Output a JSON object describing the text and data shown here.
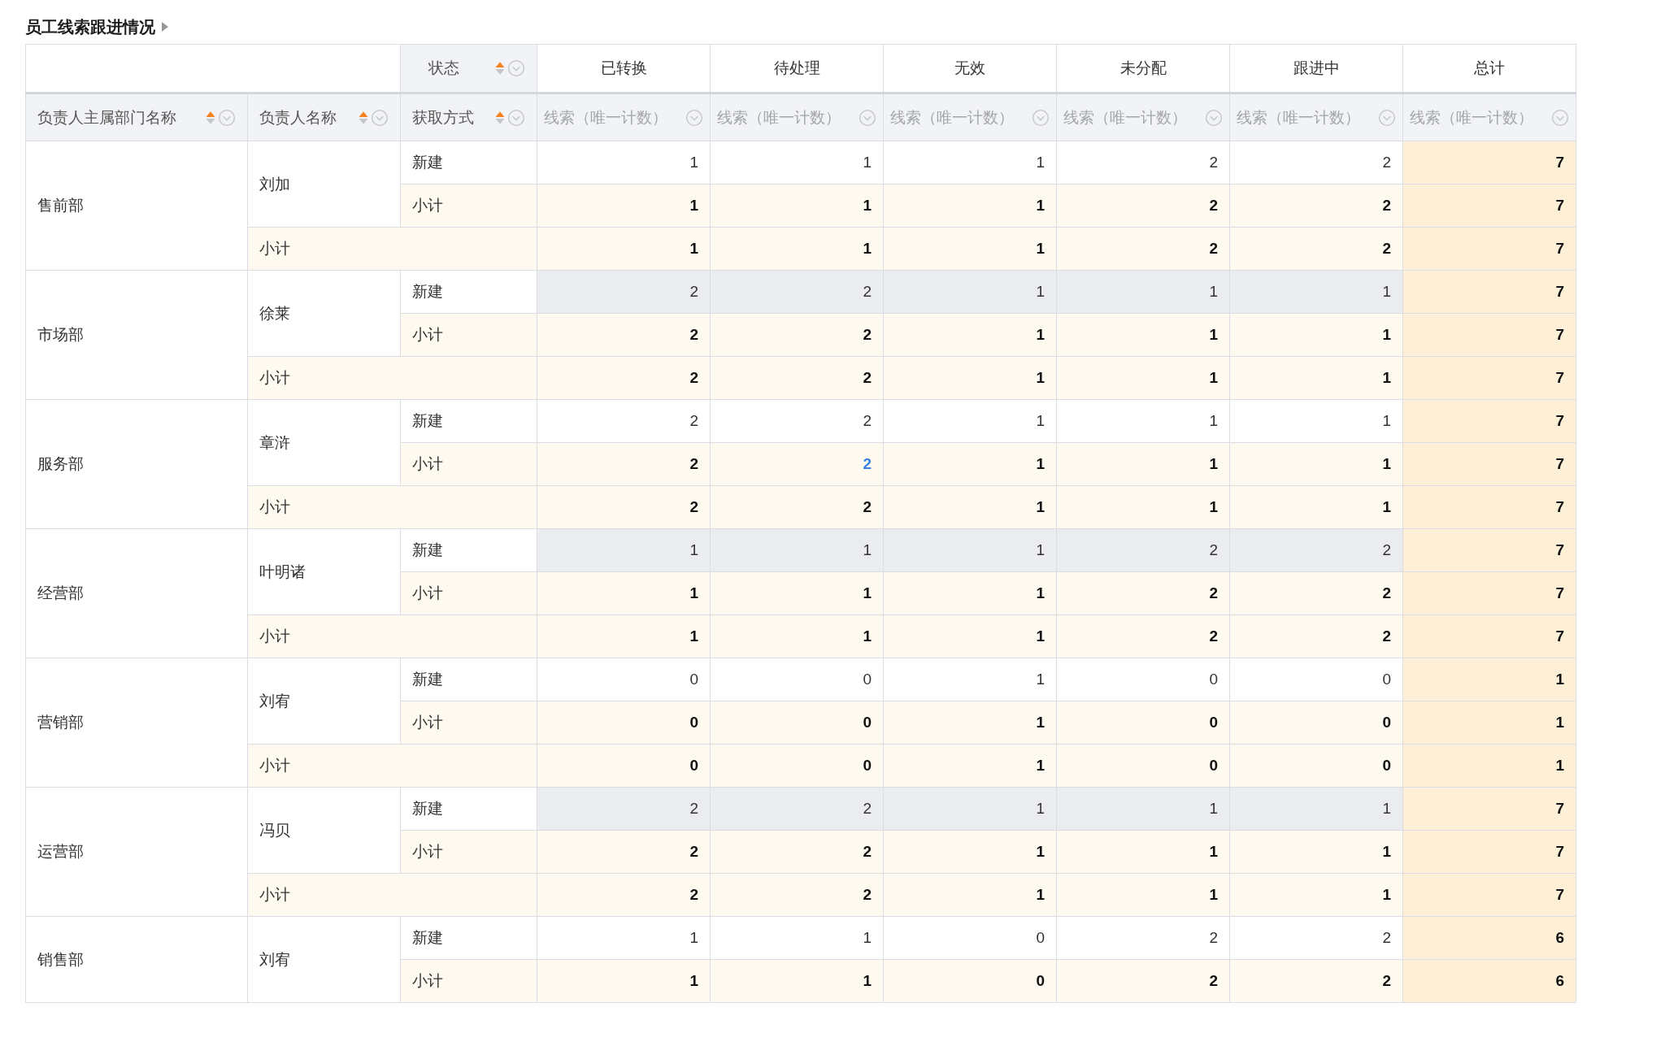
{
  "title": "员工线索跟进情况",
  "column_header": {
    "label": "状态"
  },
  "row_headers": [
    "负责人主属部门名称",
    "负责人名称",
    "获取方式"
  ],
  "columns": [
    {
      "label": "已转换",
      "measure": "线索（唯一计数）"
    },
    {
      "label": "待处理",
      "measure": "线索（唯一计数）"
    },
    {
      "label": "无效",
      "measure": "线索（唯一计数）"
    },
    {
      "label": "未分配",
      "measure": "线索（唯一计数）"
    },
    {
      "label": "跟进中",
      "measure": "线索（唯一计数）"
    },
    {
      "label": "总计",
      "measure": "线索（唯一计数）"
    }
  ],
  "groups": [
    {
      "dept": "售前部",
      "person": "刘加",
      "rows": [
        {
          "kind": "detail",
          "label": "新建",
          "shaded": false,
          "values": [
            "1",
            "1",
            "1",
            "2",
            "2",
            "7"
          ]
        },
        {
          "kind": "person_subtotal",
          "label": "小计",
          "values": [
            "1",
            "1",
            "1",
            "2",
            "2",
            "7"
          ]
        },
        {
          "kind": "dept_subtotal",
          "label": "小计",
          "values": [
            "1",
            "1",
            "1",
            "2",
            "2",
            "7"
          ]
        }
      ]
    },
    {
      "dept": "市场部",
      "person": "徐莱",
      "rows": [
        {
          "kind": "detail",
          "label": "新建",
          "shaded": true,
          "values": [
            "2",
            "2",
            "1",
            "1",
            "1",
            "7"
          ]
        },
        {
          "kind": "person_subtotal",
          "label": "小计",
          "values": [
            "2",
            "2",
            "1",
            "1",
            "1",
            "7"
          ]
        },
        {
          "kind": "dept_subtotal",
          "label": "小计",
          "values": [
            "2",
            "2",
            "1",
            "1",
            "1",
            "7"
          ]
        }
      ]
    },
    {
      "dept": "服务部",
      "person": "章浒",
      "rows": [
        {
          "kind": "detail",
          "label": "新建",
          "shaded": false,
          "values": [
            "2",
            "2",
            "1",
            "1",
            "1",
            "7"
          ]
        },
        {
          "kind": "person_subtotal",
          "label": "小计",
          "links": [
            false,
            true,
            false,
            false,
            false,
            false
          ],
          "values": [
            "2",
            "2",
            "1",
            "1",
            "1",
            "7"
          ]
        },
        {
          "kind": "dept_subtotal",
          "label": "小计",
          "values": [
            "2",
            "2",
            "1",
            "1",
            "1",
            "7"
          ]
        }
      ]
    },
    {
      "dept": "经营部",
      "person": "叶明诸",
      "rows": [
        {
          "kind": "detail",
          "label": "新建",
          "shaded": true,
          "values": [
            "1",
            "1",
            "1",
            "2",
            "2",
            "7"
          ]
        },
        {
          "kind": "person_subtotal",
          "label": "小计",
          "values": [
            "1",
            "1",
            "1",
            "2",
            "2",
            "7"
          ]
        },
        {
          "kind": "dept_subtotal",
          "label": "小计",
          "values": [
            "1",
            "1",
            "1",
            "2",
            "2",
            "7"
          ]
        }
      ]
    },
    {
      "dept": "营销部",
      "person": "刘宥",
      "rows": [
        {
          "kind": "detail",
          "label": "新建",
          "shaded": false,
          "values": [
            "0",
            "0",
            "1",
            "0",
            "0",
            "1"
          ]
        },
        {
          "kind": "person_subtotal",
          "label": "小计",
          "values": [
            "0",
            "0",
            "1",
            "0",
            "0",
            "1"
          ]
        },
        {
          "kind": "dept_subtotal",
          "label": "小计",
          "values": [
            "0",
            "0",
            "1",
            "0",
            "0",
            "1"
          ]
        }
      ]
    },
    {
      "dept": "运营部",
      "person": "冯贝",
      "rows": [
        {
          "kind": "detail",
          "label": "新建",
          "shaded": true,
          "values": [
            "2",
            "2",
            "1",
            "1",
            "1",
            "7"
          ]
        },
        {
          "kind": "person_subtotal",
          "label": "小计",
          "values": [
            "2",
            "2",
            "1",
            "1",
            "1",
            "7"
          ]
        },
        {
          "kind": "dept_subtotal",
          "label": "小计",
          "values": [
            "2",
            "2",
            "1",
            "1",
            "1",
            "7"
          ]
        }
      ]
    },
    {
      "dept": "销售部",
      "person": "刘宥",
      "rows": [
        {
          "kind": "detail",
          "label": "新建",
          "shaded": false,
          "values": [
            "1",
            "1",
            "0",
            "2",
            "2",
            "6"
          ]
        },
        {
          "kind": "person_subtotal",
          "label": "小计",
          "values": [
            "1",
            "1",
            "0",
            "2",
            "2",
            "6"
          ]
        }
      ]
    }
  ]
}
